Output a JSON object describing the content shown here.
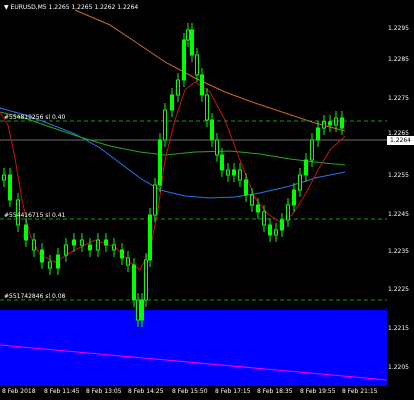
{
  "header": {
    "symbol": "EURUSD,M5",
    "ohlc": "1.2265 1.2265 1.2262 1.2264",
    "arrow_icon": "triangle-down-icon"
  },
  "price_axis": {
    "labels": [
      "1.2295",
      "1.2285",
      "1.2275",
      "1.2265",
      "1.2255",
      "1.2245",
      "1.2235",
      "1.2225",
      "1.2215",
      "1.2205"
    ],
    "current_price": "1.2264"
  },
  "time_axis": {
    "labels": [
      "8 Feb 2018",
      "8 Feb 11:45",
      "8 Feb 13:05",
      "8 Feb 14:25",
      "8 Feb 15:50",
      "8 Feb 17:15",
      "8 Feb 18:35",
      "8 Feb 19:55",
      "8 Feb 21:15"
    ]
  },
  "orders": [
    {
      "label": "#554819256  sl  0.40"
    },
    {
      "label": "#554416715  sl  0.41"
    },
    {
      "label": "#551742846  sl  0.08"
    }
  ],
  "colors": {
    "background": "#000000",
    "candle": "#00ff00",
    "ma_red": "#cc1111",
    "ma_green": "#22aa22",
    "ma_blue": "#2277ee",
    "ma_orange": "#d2691e",
    "zone": "#0000ff",
    "trend_line": "#ff00ff",
    "level_line": "#00aa00"
  }
}
